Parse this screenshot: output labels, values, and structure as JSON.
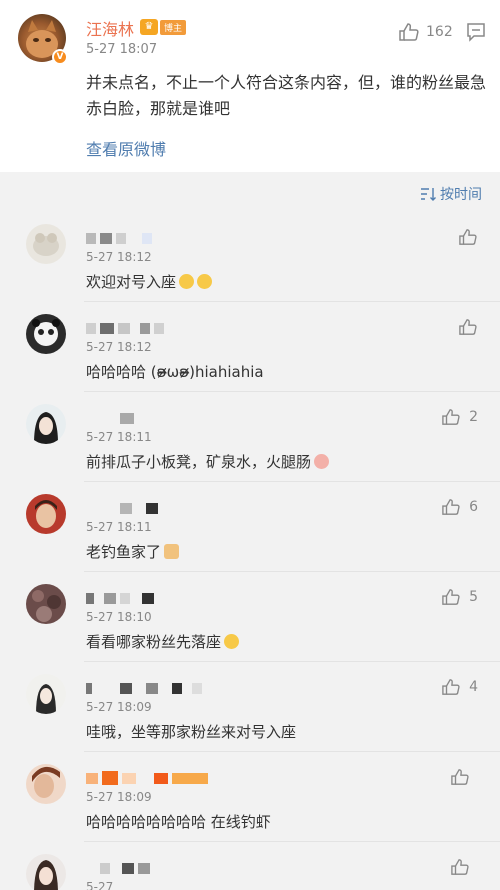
{
  "post": {
    "author": "汪海林",
    "badge": "博主",
    "time": "5-27 18:07",
    "like_count": "162",
    "text": "并未点名，不止一个人符合这条内容，但，谁的粉丝最急赤白脸，那就是谁吧",
    "view_original": "查看原微博"
  },
  "sort": {
    "label": "按时间"
  },
  "comments": [
    {
      "time": "5-27 18:12",
      "text": "欢迎对号入座",
      "likes": "",
      "emoji": [
        "grin-emoji",
        "grin-emoji"
      ]
    },
    {
      "time": "5-27 18:12",
      "text": "哈哈哈哈 (ʚ̴̶̷̷ωʚ̴̶̷̷)hiahiahia",
      "likes": "",
      "emoji": []
    },
    {
      "time": "5-27 18:11",
      "text": "前排瓜子小板凳，矿泉水，火腿肠",
      "likes": "2",
      "emoji": [
        "ham-emoji"
      ]
    },
    {
      "time": "5-27 18:11",
      "text": "老钓鱼家了",
      "likes": "6",
      "emoji": [
        "thumb-emoji"
      ]
    },
    {
      "time": "5-27 18:10",
      "text": "看看哪家粉丝先落座",
      "likes": "5",
      "emoji": [
        "smile-emoji"
      ]
    },
    {
      "time": "5-27 18:09",
      "text": "哇哦，坐等那家粉丝来对号入座",
      "likes": "4",
      "emoji": []
    },
    {
      "time": "5-27 18:09",
      "text": "哈哈哈哈哈哈哈哈 在线钓虾",
      "likes": "",
      "emoji": []
    },
    {
      "time": "5-27",
      "text": "",
      "likes": "",
      "emoji": []
    }
  ],
  "colors": {
    "name": "#eb7350",
    "link": "#507daf",
    "meta": "#888888"
  }
}
